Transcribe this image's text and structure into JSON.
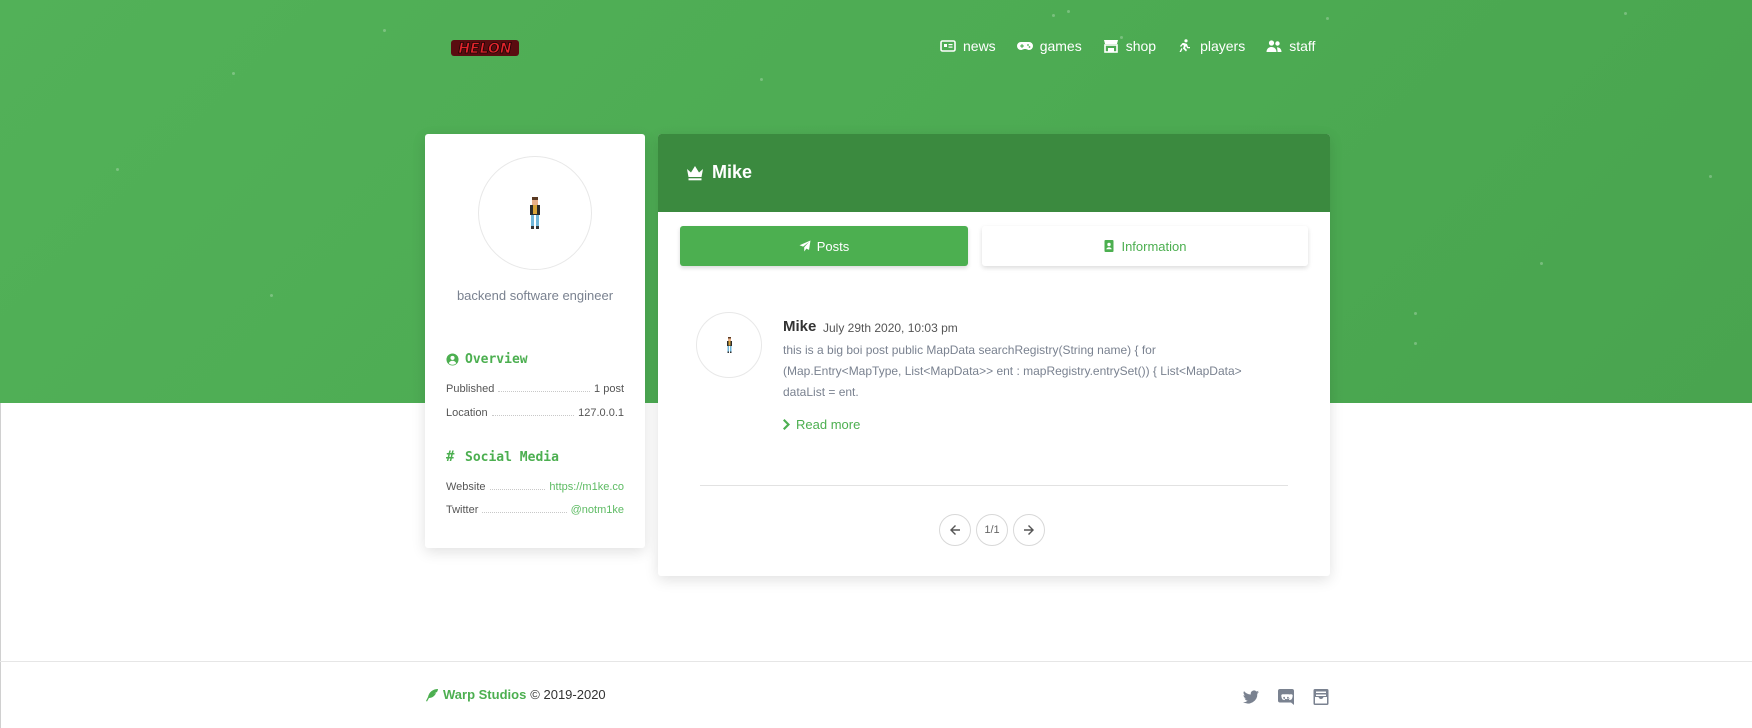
{
  "header": {
    "logo_text": "HELON",
    "nav": [
      {
        "label": "news",
        "icon": "newspaper-icon"
      },
      {
        "label": "games",
        "icon": "gamepad-icon"
      },
      {
        "label": "shop",
        "icon": "store-icon"
      },
      {
        "label": "players",
        "icon": "running-icon"
      },
      {
        "label": "staff",
        "icon": "user-group-icon"
      }
    ]
  },
  "profile": {
    "role": "backend software engineer",
    "overview_title": "Overview",
    "published_label": "Published",
    "published_value": "1 post",
    "location_label": "Location",
    "location_value": "127.0.0.1",
    "social_title": "Social Media",
    "website_label": "Website",
    "website_value": "https://m1ke.co",
    "twitter_label": "Twitter",
    "twitter_value": "@notm1ke"
  },
  "panel": {
    "title": "Mike",
    "tab_posts": "Posts",
    "tab_information": "Information"
  },
  "post": {
    "author": "Mike",
    "date": "July 29th 2020, 10:03 pm",
    "body": "this is a big boi post public MapData searchRegistry(String name) { for (Map.Entry<MapType, List<MapData>> ent : mapRegistry.entrySet()) { List<MapData> dataList = ent.",
    "read_more": "Read more"
  },
  "pager": {
    "label": "1/1"
  },
  "footer": {
    "studio": "Warp Studios",
    "copyright": "© 2019-2020"
  },
  "colors": {
    "accent": "#4caf50",
    "header_dark": "#3b8a3f"
  }
}
